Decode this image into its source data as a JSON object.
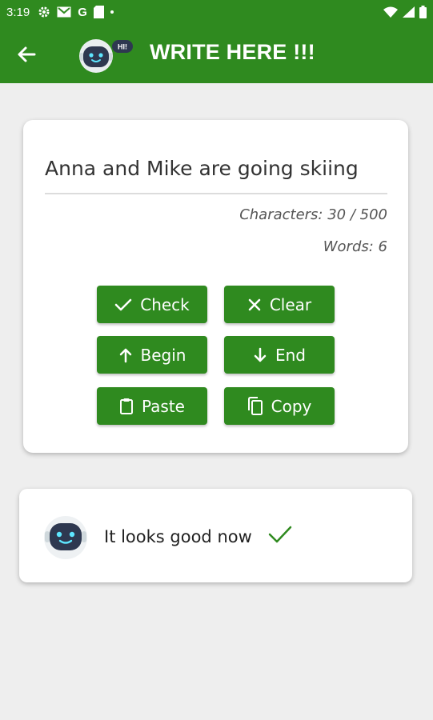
{
  "status_bar": {
    "time": "3:19",
    "left_icons": [
      "settings-icon",
      "gmail-icon",
      "google-icon",
      "sim-card-icon",
      "notification-dot-icon"
    ],
    "google_letter": "G",
    "right_icons": [
      "wifi-icon",
      "signal-icon",
      "battery-icon"
    ]
  },
  "app_bar": {
    "title": "WRITE HERE !!!",
    "logo_badge": "HI!",
    "back_icon": "arrow-left-icon"
  },
  "editor": {
    "text_value": "Anna and Mike are going skiing",
    "characters_label": "Characters: 30 / 500",
    "words_label": "Words: 6"
  },
  "buttons": {
    "check": "Check",
    "clear": "Clear",
    "begin": "Begin",
    "end": "End",
    "paste": "Paste",
    "copy": "Copy"
  },
  "feedback": {
    "message": "It looks good now",
    "status_icon": "checkmark-icon"
  },
  "colors": {
    "primary": "#2f8a1f",
    "background": "#eeeeee",
    "card": "#ffffff",
    "check_mark": "#2f8a1f"
  }
}
